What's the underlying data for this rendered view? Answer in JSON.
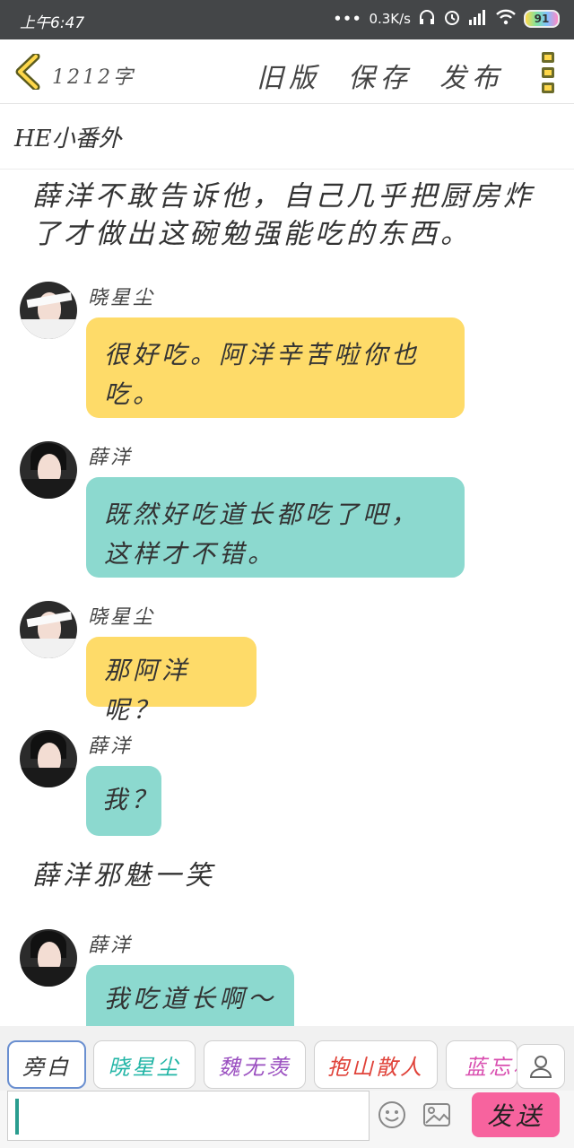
{
  "status_bar": {
    "time": "上午6:47",
    "speed": "0.3K/s",
    "battery": "91"
  },
  "header": {
    "word_count": "1212字",
    "old_version": "旧版",
    "save": "保存",
    "publish": "发布"
  },
  "chapter_title": "HE小番外",
  "narration_1": [
    "薛洋不敢告诉他，自己几乎把厨房炸",
    "了才做出这碗勉强能吃的东西。"
  ],
  "messages": [
    {
      "name": "晓星尘",
      "lines": [
        "很好吃。阿洋辛苦啦你也",
        "吃。"
      ]
    },
    {
      "name": "薛洋",
      "lines": [
        "既然好吃道长都吃了吧，",
        "这样才不错。"
      ]
    },
    {
      "name": "晓星尘",
      "lines": [
        "那阿洋呢？"
      ]
    },
    {
      "name": "薛洋",
      "lines": [
        "我？"
      ]
    },
    {
      "name": "薛洋",
      "lines": [
        "我吃道长啊～"
      ]
    }
  ],
  "narration_2": "薛洋邪魅一笑",
  "characters": [
    "旁白",
    "晓星尘",
    "魏无羡",
    "抱山散人",
    "蓝忘机"
  ],
  "colors": {
    "yellow_bubble": "#fedb69",
    "teal_bubble": "#8cd9cf",
    "send_button": "#f7639e"
  },
  "input": {
    "value": "",
    "placeholder": ""
  },
  "send_label": "发送"
}
